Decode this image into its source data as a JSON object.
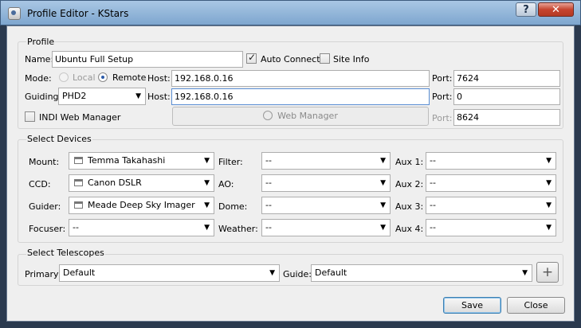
{
  "window": {
    "title": "Profile Editor - KStars",
    "help_label": "?",
    "close_label": "✕"
  },
  "profile": {
    "group_title": "Profile",
    "name_label": "Name:",
    "name_value": "Ubuntu Full Setup",
    "auto_connect_label": "Auto Connect",
    "auto_connect_checked": true,
    "site_info_label": "Site Info",
    "site_info_checked": false,
    "mode_label": "Mode:",
    "mode_local_label": "Local",
    "mode_remote_label": "Remote",
    "mode_selected": "Remote",
    "host_label": "Host:",
    "host_value": "192.168.0.16",
    "port_label": "Port:",
    "port_value": "7624",
    "guiding_label": "Guiding:",
    "guiding_value": "PHD2",
    "guiding_host_label": "Host:",
    "guiding_host_value": "192.168.0.16",
    "guiding_port_label": "Port:",
    "guiding_port_value": "0",
    "indi_web_manager_label": "INDI Web Manager",
    "indi_web_manager_checked": false,
    "web_manager_button": "Web Manager",
    "web_port_label": "Port:",
    "web_port_value": "8624"
  },
  "devices": {
    "group_title": "Select Devices",
    "mount_label": "Mount:",
    "mount_value": "Temma Takahashi",
    "ccd_label": "CCD:",
    "ccd_value": "Canon DSLR",
    "guider_label": "Guider:",
    "guider_value": "Meade Deep Sky Imager",
    "focuser_label": "Focuser:",
    "focuser_value": "--",
    "filter_label": "Filter:",
    "filter_value": "--",
    "ao_label": "AO:",
    "ao_value": "--",
    "dome_label": "Dome:",
    "dome_value": "--",
    "weather_label": "Weather:",
    "weather_value": "--",
    "aux1_label": "Aux 1:",
    "aux1_value": "--",
    "aux2_label": "Aux 2:",
    "aux2_value": "--",
    "aux3_label": "Aux 3:",
    "aux3_value": "--",
    "aux4_label": "Aux 4:",
    "aux4_value": "--"
  },
  "telescopes": {
    "group_title": "Select Telescopes",
    "primary_label": "Primary:",
    "primary_value": "Default",
    "guide_label": "Guide:",
    "guide_value": "Default",
    "add_label": "+"
  },
  "actions": {
    "save_label": "Save",
    "close_label": "Close"
  },
  "icons": {
    "app": "kstars-app-icon",
    "device": "device-icon",
    "globe": "globe-icon"
  }
}
